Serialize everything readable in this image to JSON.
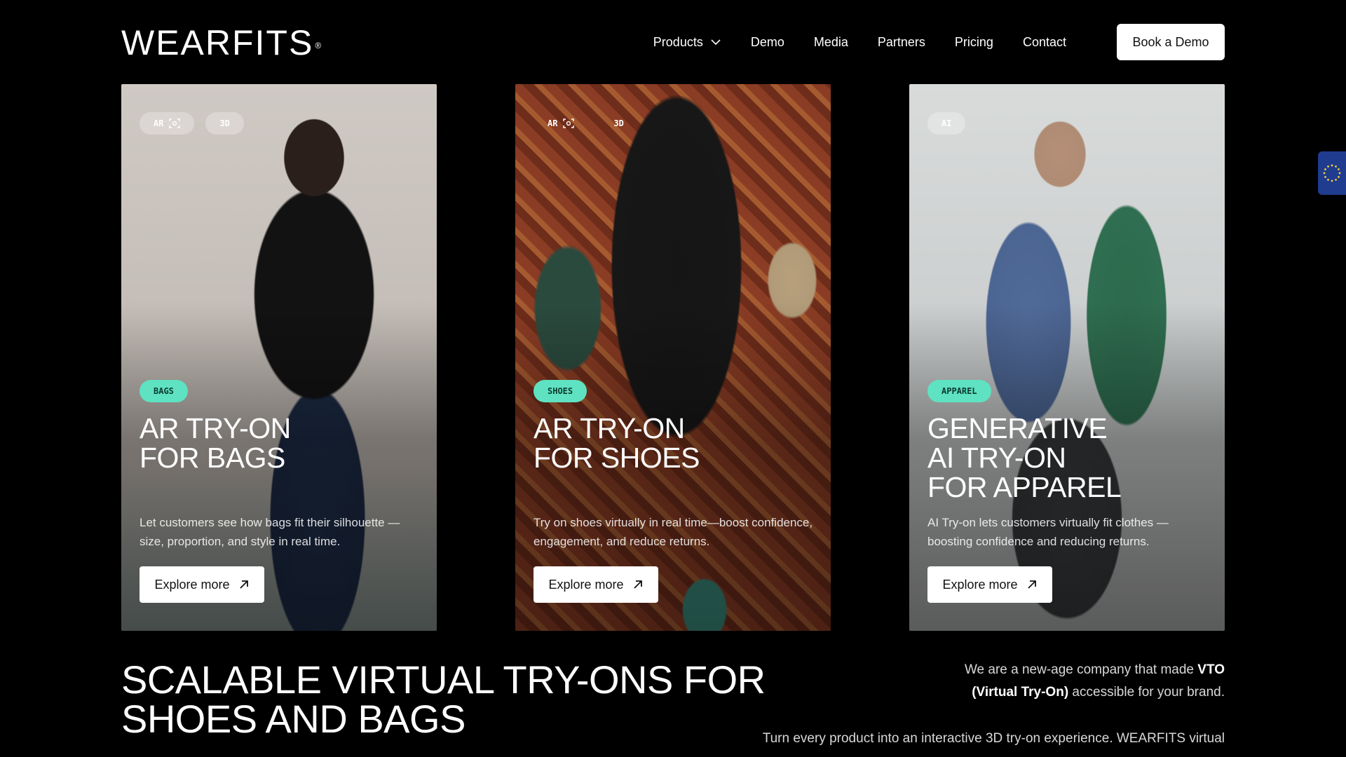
{
  "brand": {
    "logo_text": "WEARFITS",
    "registered_mark": "®"
  },
  "nav": {
    "items": [
      {
        "label": "Products",
        "has_dropdown": true
      },
      {
        "label": "Demo"
      },
      {
        "label": "Media"
      },
      {
        "label": "Partners"
      },
      {
        "label": "Pricing"
      },
      {
        "label": "Contact"
      }
    ],
    "cta_label": "Book a Demo"
  },
  "cards": [
    {
      "chips": [
        "AR",
        "3D"
      ],
      "tag": "BAGS",
      "title_lines": [
        "AR TRY-ON",
        "FOR BAGS"
      ],
      "description": "Let customers see how bags fit their silhouette —size, proportion, and style in real time.",
      "button_label": "Explore more"
    },
    {
      "chips": [
        "AR",
        "3D"
      ],
      "tag": "SHOES",
      "title_lines": [
        "AR TRY-ON",
        "FOR SHOES"
      ],
      "description": "Try on shoes virtually in real time—boost confidence, engagement, and reduce returns.",
      "button_label": "Explore more"
    },
    {
      "chips": [
        "AI"
      ],
      "tag": "APPAREL",
      "title_lines": [
        "GENERATIVE",
        "AI TRY-ON",
        "FOR APPAREL"
      ],
      "description": "AI Try-on lets customers virtually fit clothes —boosting confidence and reducing returns.",
      "button_label": "Explore more"
    }
  ],
  "hero": {
    "headline_lines": [
      "SCALABLE VIRTUAL TRY-ONS FOR",
      "SHOES AND BAGS"
    ],
    "intro_prefix": "We are a new-age company that made ",
    "intro_bold": "VTO (Virtual Try-On)",
    "intro_suffix": " accessible for your brand.",
    "paragraph": "Turn every product into an interactive 3D try-on experience. WEARFITS virtual"
  },
  "icons": {
    "products_dropdown": "chevron-down-icon",
    "ar_chip": "ar-scan-icon",
    "explore": "arrow-up-right-icon",
    "eu_badge": "eu-flag-icon"
  },
  "colors": {
    "background": "#000000",
    "tag_accent": "#5ee2c2",
    "button_bg": "#ffffff",
    "eu_blue": "#1f3c8e"
  }
}
